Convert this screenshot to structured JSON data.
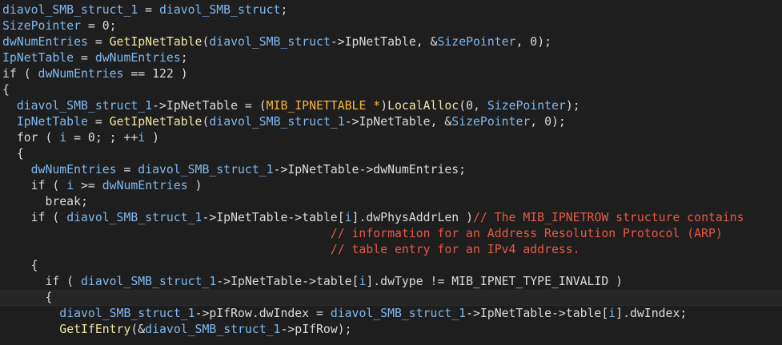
{
  "editor": {
    "lines": [
      {
        "tokens": [
          {
            "t": "diavol_SMB_struct_1",
            "c": "var"
          },
          {
            "t": " = ",
            "c": "ph"
          },
          {
            "t": "diavol_SMB_struct",
            "c": "var"
          },
          {
            "t": ";",
            "c": "ph"
          }
        ]
      },
      {
        "tokens": [
          {
            "t": "SizePointer",
            "c": "var"
          },
          {
            "t": " = 0;",
            "c": "ph"
          }
        ]
      },
      {
        "tokens": [
          {
            "t": "dwNumEntries",
            "c": "var"
          },
          {
            "t": " = ",
            "c": "ph"
          },
          {
            "t": "GetIpNetTable",
            "c": "fn"
          },
          {
            "t": "(",
            "c": "ph"
          },
          {
            "t": "diavol_SMB_struct",
            "c": "var"
          },
          {
            "t": "->IpNetTable, &",
            "c": "ph"
          },
          {
            "t": "SizePointer",
            "c": "var"
          },
          {
            "t": ", 0);",
            "c": "ph"
          }
        ]
      },
      {
        "tokens": [
          {
            "t": "IpNetTable",
            "c": "var"
          },
          {
            "t": " = ",
            "c": "ph"
          },
          {
            "t": "dwNumEntries",
            "c": "var"
          },
          {
            "t": ";",
            "c": "ph"
          }
        ]
      },
      {
        "tokens": [
          {
            "t": "if ( ",
            "c": "ph"
          },
          {
            "t": "dwNumEntries",
            "c": "var"
          },
          {
            "t": " == 122 )",
            "c": "ph"
          }
        ]
      },
      {
        "tokens": [
          {
            "t": "{",
            "c": "ph"
          }
        ]
      },
      {
        "tokens": [
          {
            "t": "  ",
            "c": "ph"
          },
          {
            "t": "diavol_SMB_struct_1",
            "c": "var"
          },
          {
            "t": "->IpNetTable = (",
            "c": "ph"
          },
          {
            "t": "MIB_IPNETTABLE *",
            "c": "type"
          },
          {
            "t": ")",
            "c": "ph"
          },
          {
            "t": "LocalAlloc",
            "c": "fn"
          },
          {
            "t": "(0, ",
            "c": "ph"
          },
          {
            "t": "SizePointer",
            "c": "var"
          },
          {
            "t": ");",
            "c": "ph"
          }
        ]
      },
      {
        "tokens": [
          {
            "t": "  ",
            "c": "ph"
          },
          {
            "t": "IpNetTable",
            "c": "var"
          },
          {
            "t": " = ",
            "c": "ph"
          },
          {
            "t": "GetIpNetTable",
            "c": "fn"
          },
          {
            "t": "(",
            "c": "ph"
          },
          {
            "t": "diavol_SMB_struct_1",
            "c": "var"
          },
          {
            "t": "->IpNetTable, &",
            "c": "ph"
          },
          {
            "t": "SizePointer",
            "c": "var"
          },
          {
            "t": ", 0);",
            "c": "ph"
          }
        ]
      },
      {
        "tokens": [
          {
            "t": "  for ( ",
            "c": "ph"
          },
          {
            "t": "i",
            "c": "var"
          },
          {
            "t": " = 0; ; ++",
            "c": "ph"
          },
          {
            "t": "i",
            "c": "var"
          },
          {
            "t": " )",
            "c": "ph"
          }
        ]
      },
      {
        "tokens": [
          {
            "t": "  {",
            "c": "ph"
          }
        ]
      },
      {
        "tokens": [
          {
            "t": "    ",
            "c": "ph"
          },
          {
            "t": "dwNumEntries",
            "c": "var"
          },
          {
            "t": " = ",
            "c": "ph"
          },
          {
            "t": "diavol_SMB_struct_1",
            "c": "var"
          },
          {
            "t": "->IpNetTable->dwNumEntries;",
            "c": "ph"
          }
        ]
      },
      {
        "tokens": [
          {
            "t": "    if ( ",
            "c": "ph"
          },
          {
            "t": "i",
            "c": "var"
          },
          {
            "t": " >= ",
            "c": "ph"
          },
          {
            "t": "dwNumEntries",
            "c": "var"
          },
          {
            "t": " )",
            "c": "ph"
          }
        ]
      },
      {
        "tokens": [
          {
            "t": "      break;",
            "c": "ph"
          }
        ]
      },
      {
        "tokens": [
          {
            "t": "    if ( ",
            "c": "ph"
          },
          {
            "t": "diavol_SMB_struct_1",
            "c": "var"
          },
          {
            "t": "->IpNetTable->table[",
            "c": "ph"
          },
          {
            "t": "i",
            "c": "var"
          },
          {
            "t": "].dwPhysAddrLen )",
            "c": "ph"
          },
          {
            "t": "// The MIB_IPNETROW structure contains",
            "c": "cmt"
          }
        ]
      },
      {
        "tokens": [
          {
            "t": "                                              ",
            "c": "ph"
          },
          {
            "t": "// information for an Address Resolution Protocol (ARP)",
            "c": "cmt"
          }
        ]
      },
      {
        "tokens": [
          {
            "t": "                                              ",
            "c": "ph"
          },
          {
            "t": "// table entry for an IPv4 address.",
            "c": "cmt"
          }
        ]
      },
      {
        "tokens": [
          {
            "t": "    {",
            "c": "ph"
          }
        ]
      },
      {
        "tokens": [
          {
            "t": "      if ( ",
            "c": "ph"
          },
          {
            "t": "diavol_SMB_struct_1",
            "c": "var"
          },
          {
            "t": "->IpNetTable->table[",
            "c": "ph"
          },
          {
            "t": "i",
            "c": "var"
          },
          {
            "t": "].dwType != MIB_IPNET_TYPE_INVALID )",
            "c": "ph"
          }
        ]
      },
      {
        "tokens": [
          {
            "t": "      {",
            "c": "ph"
          }
        ],
        "current": true
      },
      {
        "tokens": [
          {
            "t": "        ",
            "c": "ph"
          },
          {
            "t": "diavol_SMB_struct_1",
            "c": "var"
          },
          {
            "t": "->pIfRow.dwIndex = ",
            "c": "ph"
          },
          {
            "t": "diavol_SMB_struct_1",
            "c": "var"
          },
          {
            "t": "->IpNetTable->table[",
            "c": "ph"
          },
          {
            "t": "i",
            "c": "var"
          },
          {
            "t": "].dwIndex;",
            "c": "ph"
          }
        ]
      },
      {
        "tokens": [
          {
            "t": "        ",
            "c": "ph"
          },
          {
            "t": "GetIfEntry",
            "c": "fn"
          },
          {
            "t": "(&",
            "c": "ph"
          },
          {
            "t": "diavol_SMB_struct_1",
            "c": "var"
          },
          {
            "t": "->pIfRow);",
            "c": "ph"
          }
        ]
      }
    ]
  },
  "colors": {
    "background": "#1e1e1e",
    "current_line": "#252526",
    "plain_text": "#dadadb",
    "identifier": "#7fb8ee",
    "function": "#efe6a5",
    "type": "#f5b53b",
    "comment": "#e25b45"
  }
}
